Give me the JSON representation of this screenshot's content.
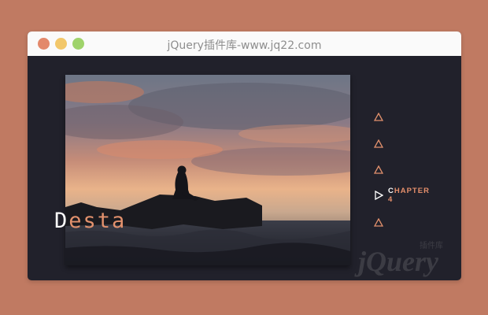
{
  "window": {
    "title": "jQuery插件库-www.jq22.com"
  },
  "slide": {
    "caption_first": "D",
    "caption_rest": "esta",
    "image_alt": "silhouette-on-rock-at-sunset"
  },
  "nav": {
    "items": [
      {
        "label": "",
        "active": false
      },
      {
        "label": "",
        "active": false
      },
      {
        "label": "",
        "active": false
      },
      {
        "label_first": "C",
        "label_rest": "HAPTER 4",
        "active": true
      },
      {
        "label": "",
        "active": false
      }
    ]
  },
  "watermark": {
    "text": "jQuery",
    "sub": "插件库"
  },
  "colors": {
    "page_bg": "#c07a62",
    "window_bg": "#21212b",
    "accent": "#e2916d",
    "active_icon": "#ffffff"
  }
}
